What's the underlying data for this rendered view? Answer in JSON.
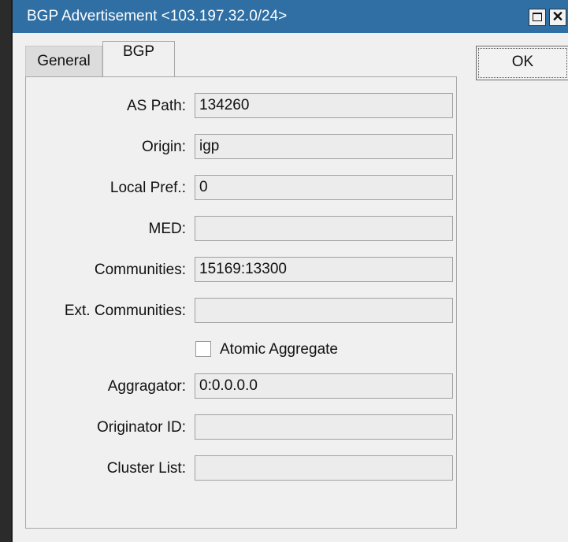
{
  "window": {
    "title": "BGP Advertisement <103.197.32.0/24>",
    "close_glyph": "✕"
  },
  "tabs": [
    {
      "label": "General",
      "active": false
    },
    {
      "label": "BGP",
      "active": true
    }
  ],
  "buttons": {
    "ok": "OK"
  },
  "form": {
    "as_path": {
      "label": "AS Path:",
      "value": "134260"
    },
    "origin": {
      "label": "Origin:",
      "value": "igp"
    },
    "local_pref": {
      "label": "Local Pref.:",
      "value": "0"
    },
    "med": {
      "label": "MED:",
      "value": ""
    },
    "communities": {
      "label": "Communities:",
      "value": "15169:13300"
    },
    "ext_communities": {
      "label": "Ext. Communities:",
      "value": ""
    },
    "atomic_aggregate": {
      "label": "Atomic Aggregate",
      "checked": false
    },
    "aggregator": {
      "label": "Aggragator:",
      "value": "0:0.0.0.0"
    },
    "originator_id": {
      "label": "Originator ID:",
      "value": ""
    },
    "cluster_list": {
      "label": "Cluster List:",
      "value": ""
    }
  },
  "colors": {
    "titlebar": "#2f6fa3",
    "background": "#f0f0f0",
    "desktop": "#2b2b2b"
  }
}
